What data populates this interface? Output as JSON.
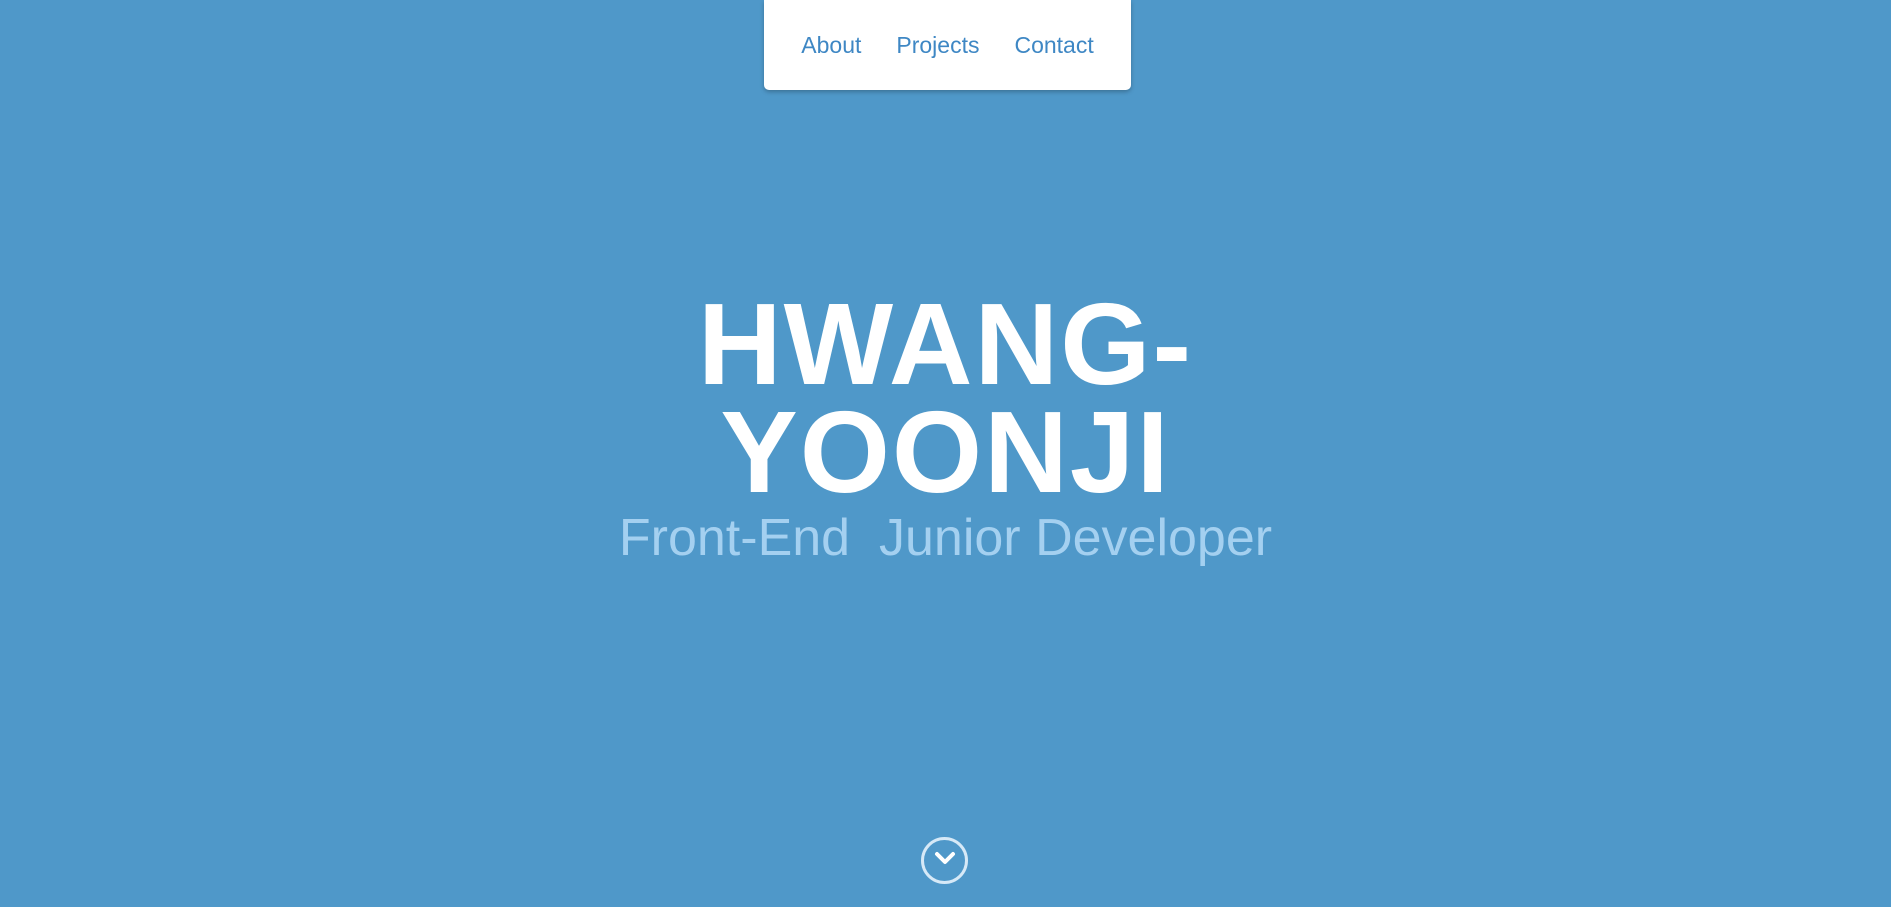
{
  "nav": {
    "items": [
      {
        "label": "About"
      },
      {
        "label": "Projects"
      },
      {
        "label": "Contact"
      }
    ]
  },
  "hero": {
    "name": "HWANG-YOONJI",
    "subtitle": "Front-End  Junior Developer"
  },
  "scroll_button": {
    "icon": "chevron-down-icon"
  },
  "colors": {
    "background": "#4f98c9",
    "nav_background": "#ffffff",
    "nav_link": "#3e87c4",
    "name": "#ffffff",
    "subtitle": "#a4d0f0"
  }
}
